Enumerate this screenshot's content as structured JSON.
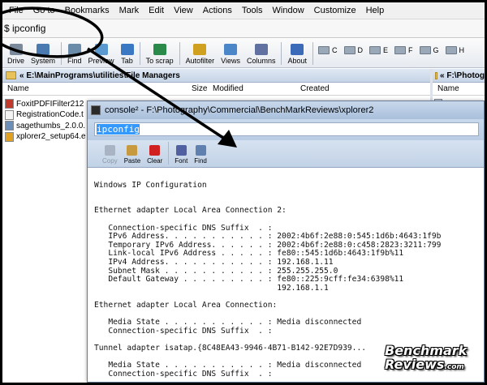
{
  "menubar": {
    "items": [
      "File",
      "Go to",
      "Bookmarks",
      "Mark",
      "Edit",
      "View",
      "Actions",
      "Tools",
      "Window",
      "Customize",
      "Help"
    ]
  },
  "command_bar": {
    "text": "$ ipconfig"
  },
  "toolbar": {
    "buttons": [
      {
        "label": "Drive",
        "icon": "drive-icon"
      },
      {
        "label": "System",
        "icon": "system-icon"
      },
      {
        "label": "Find",
        "icon": "find-icon"
      },
      {
        "label": "Preview",
        "icon": "preview-icon"
      },
      {
        "label": "Tab",
        "icon": "tab-icon"
      },
      {
        "label": "To scrap",
        "icon": "scrap-icon"
      },
      {
        "label": "Autofilter",
        "icon": "autofilter-icon"
      },
      {
        "label": "Views",
        "icon": "views-icon"
      },
      {
        "label": "Columns",
        "icon": "columns-icon"
      },
      {
        "label": "About",
        "icon": "about-icon"
      }
    ],
    "drives": [
      "C",
      "D",
      "E",
      "F",
      "G",
      "H"
    ]
  },
  "left_pane": {
    "path": "« E:\\MainPrograms\\utilities\\File Managers",
    "columns": {
      "name": "Name",
      "size": "Size",
      "modified": "Modified",
      "created": "Created"
    },
    "files": [
      {
        "name": "FoxitPDFIFilter212",
        "icon_color": "#c0392b"
      },
      {
        "name": "RegistrationCode.t",
        "icon_color": "#f4f4f4"
      },
      {
        "name": "sagethumbs_2.0.0.",
        "icon_color": "#6b8fb8"
      },
      {
        "name": "xplorer2_setup64.e",
        "icon_color": "#e2a020"
      }
    ]
  },
  "right_pane": {
    "path": "« F:\\Photog",
    "columns": {
      "name": "Name"
    }
  },
  "console": {
    "title": "console² - F:\\Photography\\Commercial\\BenchMarkReviews\\xplorer2",
    "input": "ipconfig",
    "tools": [
      {
        "label": "Copy",
        "icon": "copy-icon",
        "disabled": true
      },
      {
        "label": "Paste",
        "icon": "paste-icon",
        "disabled": false
      },
      {
        "label": "Clear",
        "icon": "clear-icon",
        "disabled": false
      },
      {
        "label": "Font",
        "icon": "font-icon",
        "disabled": false
      },
      {
        "label": "Find",
        "icon": "find-icon",
        "disabled": false
      }
    ],
    "output": [
      "",
      "Windows IP Configuration",
      "",
      "",
      "Ethernet adapter Local Area Connection 2:",
      "",
      "   Connection-specific DNS Suffix  . :",
      "   IPv6 Address. . . . . . . . . . . : 2002:4b6f:2e88:0:545:1d6b:4643:1f9b",
      "   Temporary IPv6 Address. . . . . . : 2002:4b6f:2e88:0:c458:2823:3211:799",
      "   Link-local IPv6 Address . . . . . : fe80::545:1d6b:4643:1f9b%11",
      "   IPv4 Address. . . . . . . . . . . : 192.168.1.11",
      "   Subnet Mask . . . . . . . . . . . : 255.255.255.0",
      "   Default Gateway . . . . . . . . . : fe80::225:9cff:fe34:6398%11",
      "                                       192.168.1.1",
      "",
      "Ethernet adapter Local Area Connection:",
      "",
      "   Media State . . . . . . . . . . . : Media disconnected",
      "   Connection-specific DNS Suffix  . :",
      "",
      "Tunnel adapter isatap.{8C48EA43-9946-4B71-B142-92E7D939...",
      "",
      "   Media State . . . . . . . . . . . : Media disconnected",
      "   Connection-specific DNS Suffix  . :"
    ]
  },
  "watermark": {
    "line1": "Benchmark",
    "line2": "Reviews",
    "suffix": ".com"
  }
}
